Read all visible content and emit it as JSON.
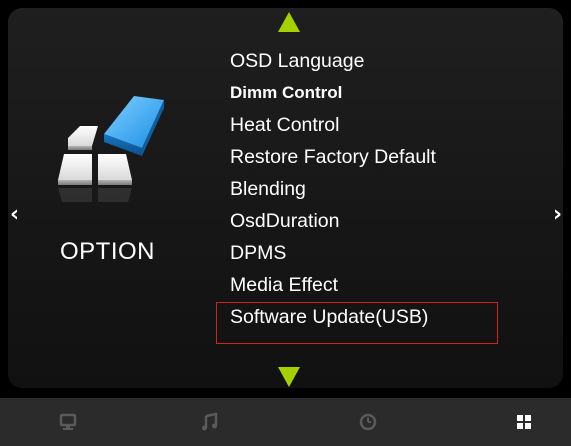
{
  "menu": {
    "category_label": "OPTION",
    "items": [
      {
        "label": "OSD Language"
      },
      {
        "label": "Dimm Control"
      },
      {
        "label": "Heat Control"
      },
      {
        "label": "Restore Factory Default"
      },
      {
        "label": "Blending"
      },
      {
        "label": "OsdDuration"
      },
      {
        "label": "DPMS"
      },
      {
        "label": "Media Effect"
      },
      {
        "label": "Software Update(USB)"
      }
    ],
    "selected_index": 8
  },
  "navigation": {
    "left_arrow": "‹",
    "right_arrow": "›"
  },
  "bottom_tabs": [
    {
      "icon": "monitor-icon",
      "active": false
    },
    {
      "icon": "music-note-icon",
      "active": false
    },
    {
      "icon": "clock-icon",
      "active": false
    },
    {
      "icon": "option-grid-icon",
      "active": true
    }
  ],
  "colors": {
    "accent_arrow": "#a6d100",
    "selection_border": "#d21f1f",
    "text": "#ffffff",
    "bottom_bar": "#2b2b2b",
    "inactive_icon": "#5a5a5a"
  }
}
